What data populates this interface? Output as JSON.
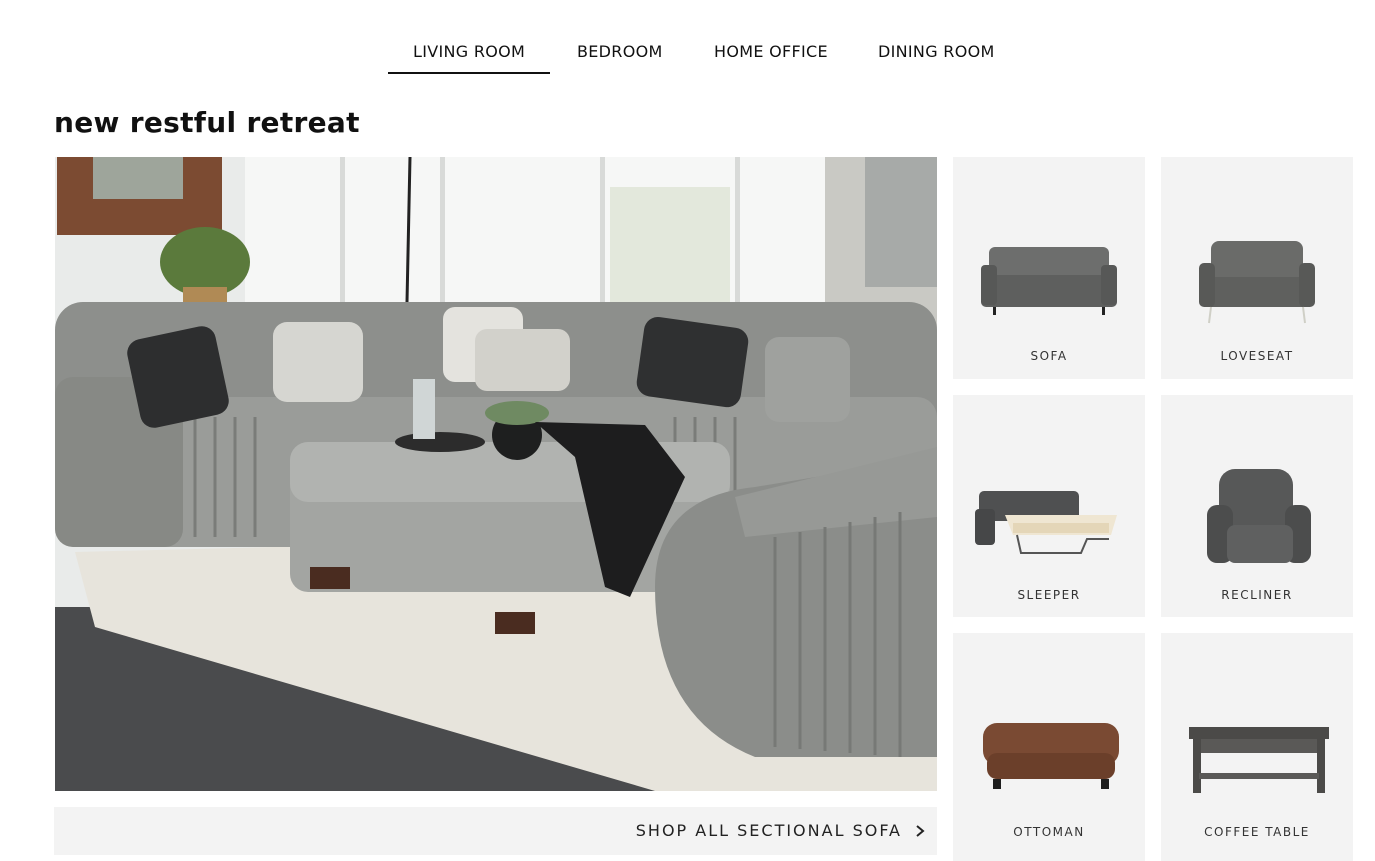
{
  "nav": {
    "tabs": [
      {
        "label": "LIVING ROOM",
        "active": true
      },
      {
        "label": "BEDROOM",
        "active": false
      },
      {
        "label": "HOME OFFICE",
        "active": false
      },
      {
        "label": "DINING ROOM",
        "active": false
      }
    ]
  },
  "page": {
    "title": "new restful retreat"
  },
  "hero": {
    "image_description": "Gray corded sectional sofa in a living room with ottoman, rug and pillows",
    "cta_label": "SHOP ALL SECTIONAL SOFA"
  },
  "categories": [
    {
      "label": "SOFA",
      "icon": "sofa-icon"
    },
    {
      "label": "LOVESEAT",
      "icon": "loveseat-icon"
    },
    {
      "label": "SLEEPER",
      "icon": "sleeper-icon"
    },
    {
      "label": "RECLINER",
      "icon": "recliner-icon"
    },
    {
      "label": "OTTOMAN",
      "icon": "ottoman-icon"
    },
    {
      "label": "COFFEE TABLE",
      "icon": "coffee-table-icon"
    }
  ],
  "colors": {
    "panel_bg": "#f3f3f3",
    "text": "#111111",
    "upholstery_gray": "#8c8e8b",
    "ottoman_brown": "#6b3f2a"
  }
}
